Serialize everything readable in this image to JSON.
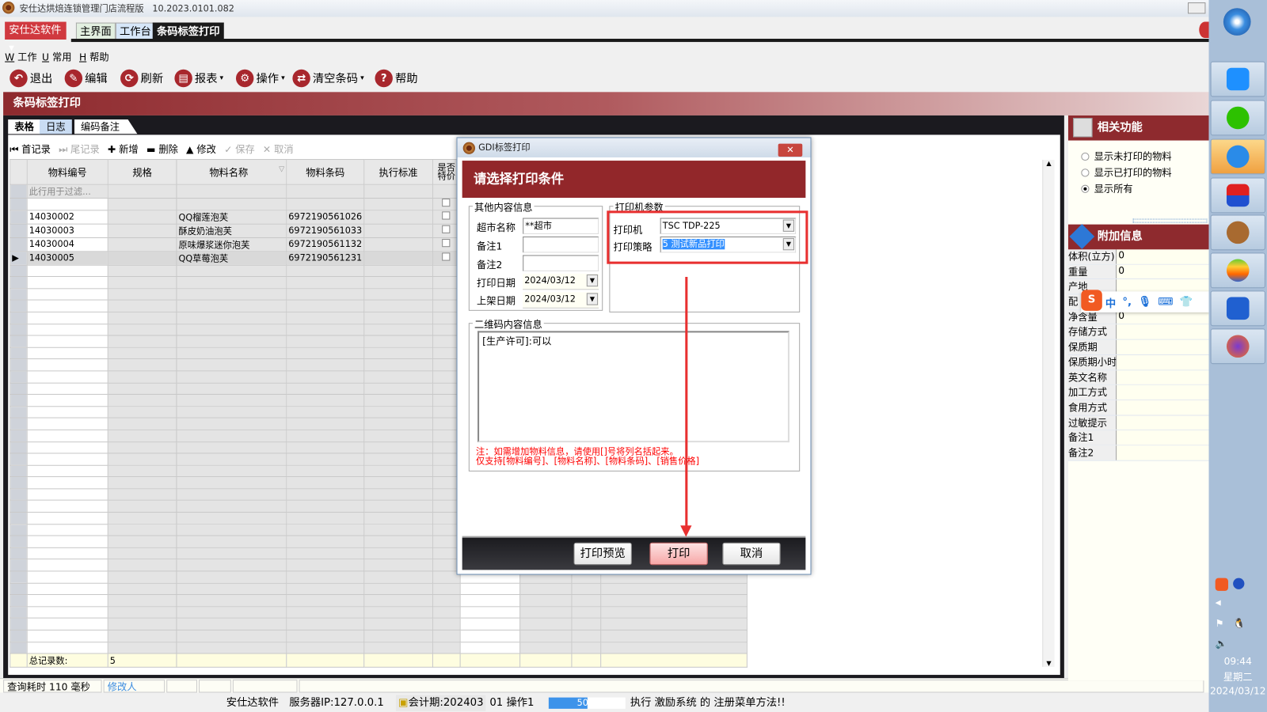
{
  "window": {
    "title": "安仕达烘焙连锁管理门店流程版",
    "version": "10.2023.0101.082"
  },
  "app_menu": "安仕达软件",
  "top_tabs": [
    "主界面",
    "工作台",
    "条码标签打印"
  ],
  "menu": [
    {
      "key": "W",
      "label": "工作"
    },
    {
      "key": "U",
      "label": "常用"
    },
    {
      "key": "H",
      "label": "帮助"
    }
  ],
  "toolbar": [
    {
      "icon": "undo-icon",
      "label": "退出"
    },
    {
      "icon": "edit-icon",
      "label": "编辑"
    },
    {
      "icon": "refresh-icon",
      "label": "刷新"
    },
    {
      "icon": "printer-icon",
      "label": "报表"
    },
    {
      "icon": "gear-icon",
      "label": "操作"
    },
    {
      "icon": "clear-icon",
      "label": "清空条码"
    },
    {
      "icon": "help-icon",
      "label": "帮助"
    }
  ],
  "page_title": "条码标签打印",
  "sub_tabs": [
    "表格",
    "日志",
    "编码备注"
  ],
  "grid_toolbar": [
    "首记录",
    "尾记录",
    "新增",
    "删除",
    "修改",
    "保存",
    "取消"
  ],
  "grid": {
    "headers": [
      "物料编号",
      "规格",
      "物料名称",
      "物料条码",
      "执行标准",
      "是否特价"
    ],
    "filter_placeholder": "此行用于过滤...",
    "rows": [
      {
        "code": "14030002",
        "spec": "",
        "name": "QQ榴莲泡芙",
        "barcode": "6972190561026",
        "std": ""
      },
      {
        "code": "14030003",
        "spec": "",
        "name": "酥皮奶油泡芙",
        "barcode": "6972190561033",
        "std": ""
      },
      {
        "code": "14030004",
        "spec": "",
        "name": "原味爆浆迷你泡芙",
        "barcode": "6972190561132",
        "std": ""
      },
      {
        "code": "14030005",
        "spec": "",
        "name": "QQ草莓泡芙",
        "barcode": "6972190561231",
        "std": ""
      }
    ],
    "footer_label": "总记录数:",
    "footer_count": "5"
  },
  "status": {
    "query_time": "查询耗时 110 毫秒",
    "modifier": "修改人"
  },
  "bottom": {
    "company": "安仕达软件",
    "server": "服务器IP:127.0.0.1",
    "period": "会计期:202403",
    "operator": "01 操作1",
    "progress_label": "50%",
    "progress": 0.5,
    "message": "执行 激励系统 的 注册菜单方法!!"
  },
  "right_panel": {
    "related_title": "相关功能",
    "radios": [
      {
        "label": "显示未打印的物料",
        "checked": false
      },
      {
        "label": "显示已打印的物料",
        "checked": false
      },
      {
        "label": "显示所有",
        "checked": true
      }
    ],
    "extra_title": "附加信息",
    "fields": [
      {
        "k": "体积(立方)",
        "v": "0"
      },
      {
        "k": "重量",
        "v": "0"
      },
      {
        "k": "产地",
        "v": ""
      },
      {
        "k": "配",
        "v": ""
      },
      {
        "k": "净含量",
        "v": "0"
      },
      {
        "k": "存储方式",
        "v": ""
      },
      {
        "k": "保质期",
        "v": ""
      },
      {
        "k": "保质期小时",
        "v": ""
      },
      {
        "k": "英文名称",
        "v": ""
      },
      {
        "k": "加工方式",
        "v": ""
      },
      {
        "k": "食用方式",
        "v": ""
      },
      {
        "k": "过敏提示",
        "v": ""
      },
      {
        "k": "备注1",
        "v": ""
      },
      {
        "k": "备注2",
        "v": ""
      }
    ]
  },
  "ime": {
    "lang": "中",
    "punct": "°,"
  },
  "clock": {
    "time": "09:44",
    "weekday": "星期二",
    "date": "2024/03/12"
  },
  "dialog": {
    "title": "GDI标签打印",
    "close": "✕",
    "header": "请选择打印条件",
    "other_group": "其他内容信息",
    "store_label": "超市名称",
    "store_value": "**超市",
    "note1_label": "备注1",
    "note1_value": "",
    "note2_label": "备注2",
    "note2_value": "",
    "print_date_label": "打印日期",
    "print_date": "2024/03/12",
    "shelf_date_label": "上架日期",
    "shelf_date": "2024/03/12",
    "printer_group": "打印机参数",
    "printer_label": "打印机",
    "printer_value": "TSC TDP-225",
    "strategy_label": "打印策略",
    "strategy_value": "5 测试新品打印",
    "qr_group": "二维码内容信息",
    "qr_value": "[生产许可]:可以",
    "note_line1": "注：如需增加物料信息，请使用[]号将列名括起来。",
    "note_line2": "仅支持[物料编号]、[物料名称]、[物料条码]、[销售价格]",
    "btn_preview": "打印预览",
    "btn_print": "打印",
    "btn_cancel": "取消"
  },
  "colors": {
    "brand_red": "#8e2a2e",
    "highlight_red": "#e83030",
    "note_red": "#ff0000"
  }
}
